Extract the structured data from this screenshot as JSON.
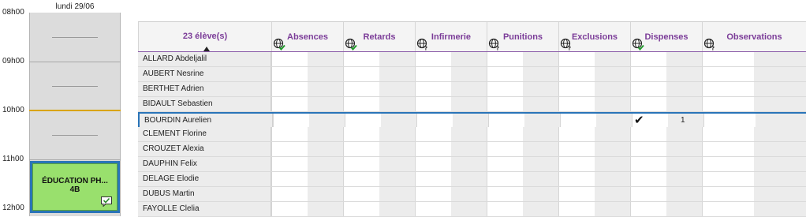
{
  "timetable": {
    "day": "lundi 29/06",
    "hours": [
      "08h00",
      "09h00",
      "10h00",
      "11h00",
      "12h00"
    ],
    "course": {
      "title": "ÉDUCATION PH...",
      "group": "4B",
      "icon": "comment-check-icon"
    }
  },
  "grid": {
    "name_header": "23 élève(s)",
    "columns": [
      "Absences",
      "Retards",
      "Infirmerie",
      "Punitions",
      "Exclusions",
      "Dispenses",
      "Observations"
    ],
    "column_icons": [
      "globe-check-icon",
      "globe-check-icon",
      "globe-question-icon",
      "globe-question-icon",
      "globe-question-icon",
      "globe-check-icon",
      "globe-question-icon"
    ],
    "students": [
      {
        "name": "ALLARD Abdeljalil"
      },
      {
        "name": "AUBERT Nesrine"
      },
      {
        "name": "BERTHET Adrien"
      },
      {
        "name": "BIDAULT Sebastien"
      },
      {
        "name": "BOURDIN Aurelien",
        "selected": true,
        "dispense_check": "✔",
        "dispense_count": "1"
      },
      {
        "name": "CLEMENT Florine"
      },
      {
        "name": "CROUZET Alexia"
      },
      {
        "name": "DAUPHIN Felix"
      },
      {
        "name": "DELAGE Elodie"
      },
      {
        "name": "DUBUS Martin"
      },
      {
        "name": "FAYOLLE Clelia"
      }
    ]
  },
  "colors": {
    "accent": "#7b3c98",
    "selection": "#2a74b8",
    "course_fill": "#99e06d",
    "now_line": "#d9a400"
  }
}
